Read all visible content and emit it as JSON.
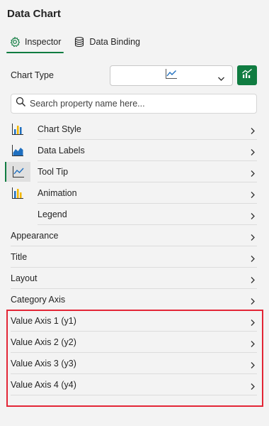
{
  "header": {
    "title": "Data Chart"
  },
  "tabs": [
    {
      "label": "Inspector",
      "icon": "gear-icon",
      "active": true
    },
    {
      "label": "Data Binding",
      "icon": "database-icon",
      "active": false
    }
  ],
  "chart_type": {
    "label": "Chart Type",
    "selected_icon": "line-chart-icon",
    "button_icon": "chart-icon"
  },
  "search": {
    "placeholder": "Search property name here..."
  },
  "sub_items": [
    {
      "label": "Chart Style",
      "icon": "bar-chart-icon"
    },
    {
      "label": "Data Labels",
      "icon": "area-chart-icon"
    },
    {
      "label": "Tool Tip",
      "icon": "line-chart-icon",
      "selected": true
    },
    {
      "label": "Animation",
      "icon": "bar-chart-icon"
    },
    {
      "label": "Legend",
      "icon": ""
    }
  ],
  "sections": [
    {
      "label": "Appearance"
    },
    {
      "label": "Title"
    },
    {
      "label": "Layout"
    },
    {
      "label": "Category Axis"
    },
    {
      "label": "Value Axis 1 (y1)"
    },
    {
      "label": "Value Axis 2 (y2)"
    },
    {
      "label": "Value Axis 3 (y3)"
    },
    {
      "label": "Value Axis 4 (y4)"
    }
  ],
  "colors": {
    "accent": "#107c41",
    "highlight": "#e32636",
    "chart_yellow": "#f2b700",
    "chart_blue": "#1f6fbf"
  }
}
